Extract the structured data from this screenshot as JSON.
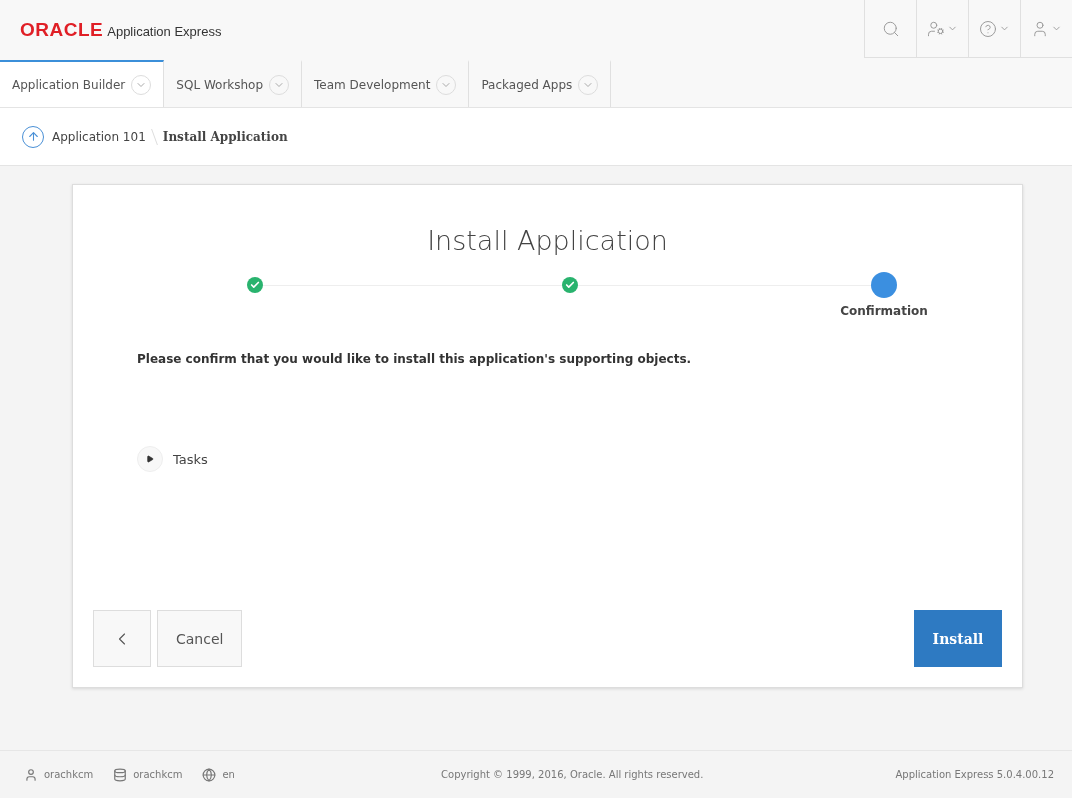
{
  "header": {
    "logo": "ORACLE",
    "product": "Application Express",
    "nav_icons": [
      {
        "kind": "search",
        "menu": false
      },
      {
        "kind": "admin",
        "menu": true
      },
      {
        "kind": "help",
        "menu": true
      },
      {
        "kind": "user",
        "menu": true
      }
    ]
  },
  "tabs": [
    {
      "label": "Application Builder",
      "selected": true
    },
    {
      "label": "SQL Workshop",
      "selected": false
    },
    {
      "label": "Team Development",
      "selected": false
    },
    {
      "label": "Packaged Apps",
      "selected": false
    }
  ],
  "breadcrumb": {
    "parent": "Application 101",
    "current": "Install Application"
  },
  "wizard": {
    "title": "Install Application",
    "steps": [
      {
        "completed": true
      },
      {
        "completed": true
      },
      {
        "completed": false,
        "label": "Confirmation"
      }
    ],
    "message": "Please confirm that you would like to install this application's supporting objects.",
    "region": {
      "label": "Tasks",
      "expanded": false
    },
    "buttons": {
      "cancel": "Cancel",
      "install": "Install"
    }
  },
  "footer": {
    "user": "orachkcm",
    "workspace": "orachkcm",
    "language": "en",
    "copyright": "Copyright © 1999, 2016, Oracle. All rights reserved.",
    "version": "Application Express 5.0.4.00.12"
  }
}
